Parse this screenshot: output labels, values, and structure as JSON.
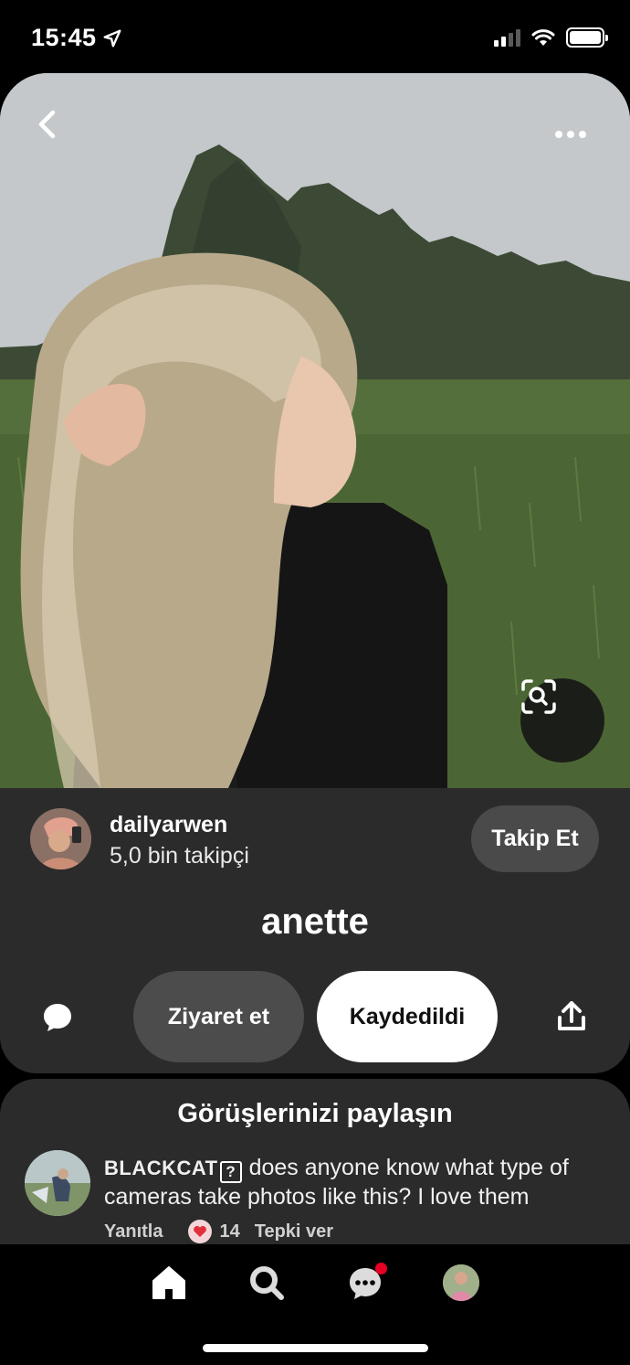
{
  "status_bar": {
    "time": "15:45",
    "location_icon": "location-arrow-icon",
    "signal_icon": "cellular-signal-icon",
    "wifi_icon": "wifi-icon",
    "battery_icon": "battery-icon"
  },
  "hero": {
    "back_icon": "chevron-left-icon",
    "more_icon": "more-dots-icon",
    "visual_search_icon": "visual-search-icon"
  },
  "author": {
    "name": "dailyarwen",
    "followers": "5,0 bin takipçi",
    "follow_label": "Takip Et"
  },
  "pin": {
    "title": "anette"
  },
  "actions": {
    "comment_icon": "comment-bubble-icon",
    "visit_label": "Ziyaret et",
    "saved_label": "Kaydedildi",
    "share_icon": "share-icon"
  },
  "comments": {
    "heading": "Görüşlerinizi paylaşın",
    "items": [
      {
        "user": "BLACKCAT",
        "badge": "?",
        "text": "does anyone know what type of cameras take photos like this? I love them",
        "reply_label": "Yanıtla",
        "reaction_count": "14",
        "react_label": "Tepki ver"
      }
    ]
  },
  "bottom_nav": {
    "items": [
      "home-icon",
      "search-icon",
      "messages-icon",
      "profile-avatar"
    ],
    "accent": "#e60023"
  }
}
